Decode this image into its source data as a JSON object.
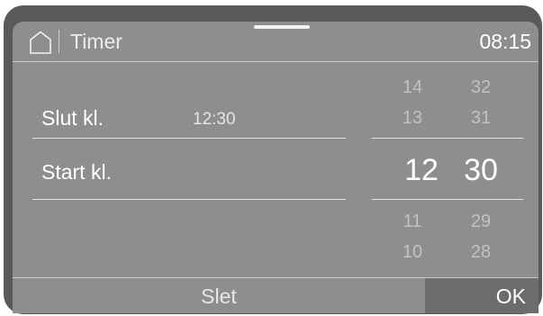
{
  "header": {
    "title": "Timer",
    "clock": "08:15"
  },
  "rows": {
    "end_label": "Slut kl.",
    "end_value": "12:30",
    "start_label": "Start kl."
  },
  "picker": {
    "hours_above": [
      "14",
      "13"
    ],
    "hour_selected": "12",
    "hours_below": [
      "11",
      "10"
    ],
    "minutes_above": [
      "32",
      "31"
    ],
    "minute_selected": "30",
    "minutes_below": [
      "29",
      "28"
    ]
  },
  "footer": {
    "delete_label": "Slet",
    "ok_label": "OK"
  }
}
